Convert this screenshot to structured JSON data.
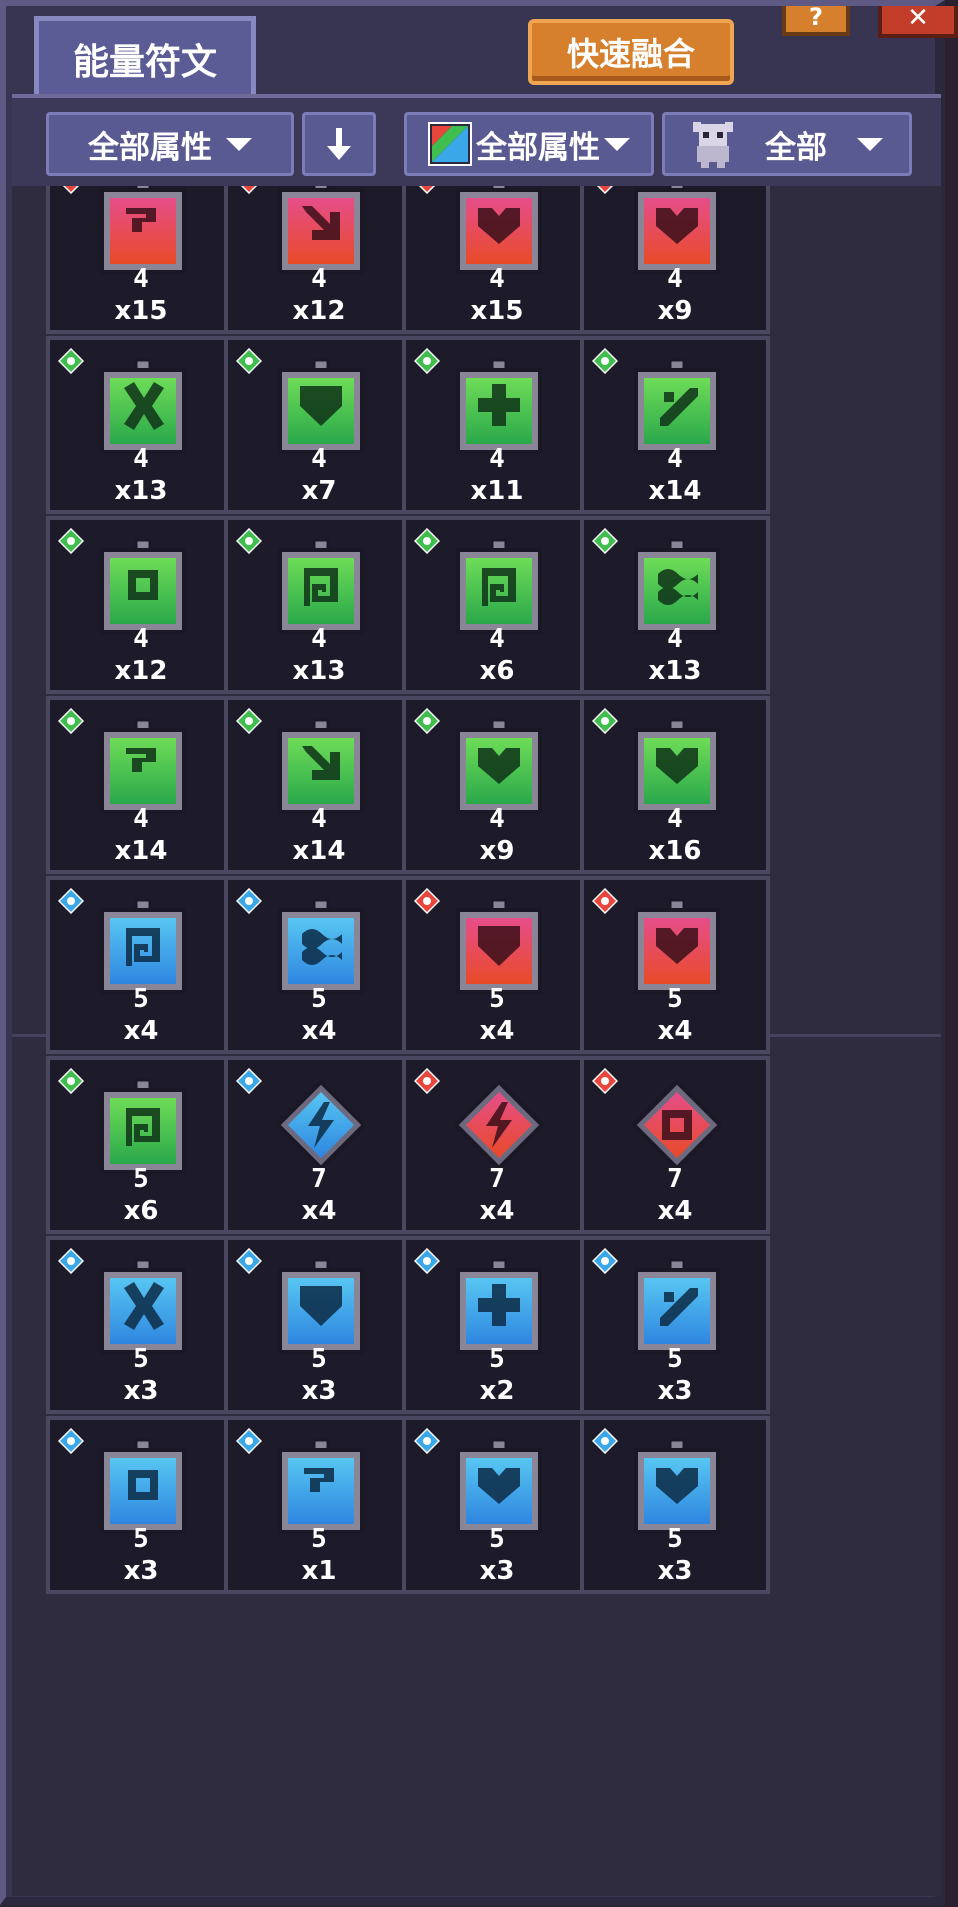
{
  "tab": {
    "label": "能量符文"
  },
  "header": {
    "fuse_label": "快速融合",
    "help_icon": "question-icon",
    "close_icon": "close-icon"
  },
  "filters": {
    "attribute_label": "全部属性",
    "sort_icon": "arrow-down-icon",
    "element_label": "全部属性",
    "character_label": "全部"
  },
  "colors": {
    "red": "#e8463c",
    "green": "#3fbe4e",
    "blue": "#3aa7e8",
    "panel": "#383552",
    "fuse": "#d6802e"
  },
  "runes": [
    {
      "element": "red",
      "shape": "frame",
      "symbol": "swirl",
      "level": "4",
      "count": "x15"
    },
    {
      "element": "red",
      "shape": "frame",
      "symbol": "arrow",
      "level": "4",
      "count": "x12"
    },
    {
      "element": "red",
      "shape": "frame",
      "symbol": "heart",
      "level": "4",
      "count": "x15"
    },
    {
      "element": "red",
      "shape": "frame",
      "symbol": "heart",
      "level": "4",
      "count": "x9"
    },
    {
      "element": "green",
      "shape": "frame",
      "symbol": "cross",
      "level": "4",
      "count": "x13"
    },
    {
      "element": "green",
      "shape": "frame",
      "symbol": "shield",
      "level": "4",
      "count": "x7"
    },
    {
      "element": "green",
      "shape": "frame",
      "symbol": "clover",
      "level": "4",
      "count": "x11"
    },
    {
      "element": "green",
      "shape": "frame",
      "symbol": "slash",
      "level": "4",
      "count": "x14"
    },
    {
      "element": "green",
      "shape": "frame",
      "symbol": "ring",
      "level": "4",
      "count": "x12"
    },
    {
      "element": "green",
      "shape": "frame",
      "symbol": "spiral",
      "level": "4",
      "count": "x13"
    },
    {
      "element": "green",
      "shape": "frame",
      "symbol": "spiral",
      "level": "4",
      "count": "x6"
    },
    {
      "element": "green",
      "shape": "frame",
      "symbol": "wave",
      "level": "4",
      "count": "x13"
    },
    {
      "element": "green",
      "shape": "frame",
      "symbol": "swirl",
      "level": "4",
      "count": "x14"
    },
    {
      "element": "green",
      "shape": "frame",
      "symbol": "arrow",
      "level": "4",
      "count": "x14"
    },
    {
      "element": "green",
      "shape": "frame",
      "symbol": "heart",
      "level": "4",
      "count": "x9"
    },
    {
      "element": "green",
      "shape": "frame",
      "symbol": "heart",
      "level": "4",
      "count": "x16"
    },
    {
      "element": "blue",
      "shape": "frame",
      "symbol": "spiral",
      "level": "5",
      "count": "x4"
    },
    {
      "element": "blue",
      "shape": "frame",
      "symbol": "wave",
      "level": "5",
      "count": "x4"
    },
    {
      "element": "red",
      "shape": "frame",
      "symbol": "shield",
      "level": "5",
      "count": "x4"
    },
    {
      "element": "red",
      "shape": "frame",
      "symbol": "heart",
      "level": "5",
      "count": "x4"
    },
    {
      "element": "green",
      "shape": "frame",
      "symbol": "spiral",
      "level": "5",
      "count": "x6"
    },
    {
      "element": "blue",
      "shape": "diamond",
      "symbol": "bolt",
      "level": "7",
      "count": "x4"
    },
    {
      "element": "red",
      "shape": "diamond",
      "symbol": "bolt",
      "level": "7",
      "count": "x4"
    },
    {
      "element": "red",
      "shape": "diamond",
      "symbol": "ring",
      "level": "7",
      "count": "x4"
    },
    {
      "element": "blue",
      "shape": "frame",
      "symbol": "cross",
      "level": "5",
      "count": "x3"
    },
    {
      "element": "blue",
      "shape": "frame",
      "symbol": "shield",
      "level": "5",
      "count": "x3"
    },
    {
      "element": "blue",
      "shape": "frame",
      "symbol": "clover",
      "level": "5",
      "count": "x2"
    },
    {
      "element": "blue",
      "shape": "frame",
      "symbol": "slash",
      "level": "5",
      "count": "x3"
    },
    {
      "element": "blue",
      "shape": "frame",
      "symbol": "ring",
      "level": "5",
      "count": "x3"
    },
    {
      "element": "blue",
      "shape": "frame",
      "symbol": "swirl",
      "level": "5",
      "count": "x1"
    },
    {
      "element": "blue",
      "shape": "frame",
      "symbol": "heart",
      "level": "5",
      "count": "x3"
    },
    {
      "element": "blue",
      "shape": "frame",
      "symbol": "heart",
      "level": "5",
      "count": "x3"
    }
  ]
}
